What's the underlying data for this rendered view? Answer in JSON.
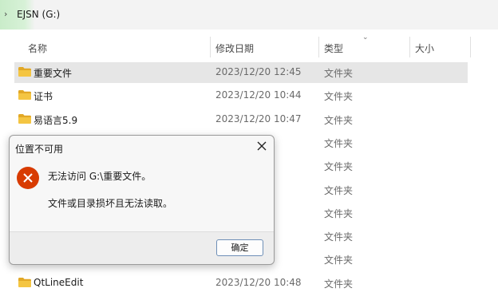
{
  "address": {
    "path": "EJSN (G:)",
    "chevron_icon": "chevron-right-icon"
  },
  "columns": {
    "name": "名称",
    "date": "修改日期",
    "type": "类型",
    "size": "大小",
    "sort_icon": "chevron-down-icon"
  },
  "rows": [
    {
      "name": "重要文件",
      "date": "2023/12/20 12:45",
      "type": "文件夹",
      "selected": true
    },
    {
      "name": "证书",
      "date": "2023/12/20 10:44",
      "type": "文件夹",
      "selected": false
    },
    {
      "name": "易语言5.9",
      "date": "2023/12/20 10:47",
      "type": "文件夹",
      "selected": false
    },
    {
      "name": "",
      "date": ":44",
      "type": "文件夹",
      "selected": false
    },
    {
      "name": "",
      "date": ":45",
      "type": "文件夹",
      "selected": false
    },
    {
      "name": "",
      "date": ":45",
      "type": "文件夹",
      "selected": false
    },
    {
      "name": "",
      "date": ":37",
      "type": "文件夹",
      "selected": false
    },
    {
      "name": "",
      "date": ":49",
      "type": "文件夹",
      "selected": false
    },
    {
      "name": "",
      "date": ":49",
      "type": "文件夹",
      "selected": false
    },
    {
      "name": "QtLineEdit",
      "date": "2023/12/20 10:48",
      "type": "文件夹",
      "selected": false
    }
  ],
  "dialog": {
    "title": "位置不可用",
    "message1": "无法访问 G:\\重要文件。",
    "message2": "文件或目录损坏且无法读取。",
    "ok_label": "确定",
    "error_icon": "error-icon",
    "close_icon": "close-icon"
  },
  "colors": {
    "folder": "#f4c542",
    "error": "#d83b01",
    "selection": "#e6e6e6"
  }
}
